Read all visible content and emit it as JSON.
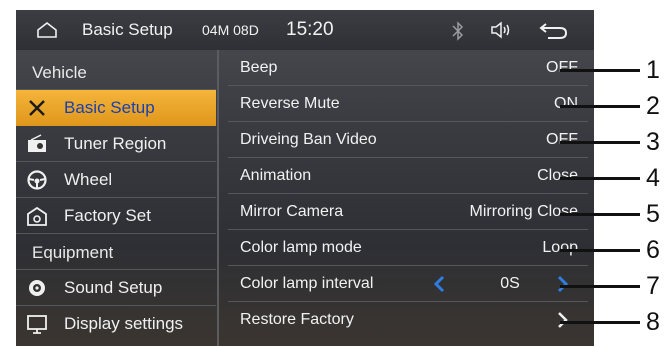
{
  "status": {
    "title": "Basic Setup",
    "date": "04M 08D",
    "time": "15:20"
  },
  "sidebar": {
    "header1": "Vehicle",
    "items1": [
      {
        "label": "Basic Setup",
        "icon": "wrench-screwdriver-icon",
        "active": true
      },
      {
        "label": "Tuner Region",
        "icon": "radio-icon"
      },
      {
        "label": "Wheel",
        "icon": "steering-wheel-icon"
      },
      {
        "label": "Factory Set",
        "icon": "factory-icon"
      }
    ],
    "header2": "Equipment",
    "items2": [
      {
        "label": "Sound Setup",
        "icon": "speaker-icon"
      },
      {
        "label": "Display settings",
        "icon": "display-icon"
      }
    ]
  },
  "settings": [
    {
      "label": "Beep",
      "value": "OFF"
    },
    {
      "label": "Reverse Mute",
      "value": "ON"
    },
    {
      "label": "Driveing Ban Video",
      "value": "OFF"
    },
    {
      "label": "Animation",
      "value": "Close"
    },
    {
      "label": "Mirror Camera",
      "value": "Mirroring Close"
    },
    {
      "label": "Color lamp mode",
      "value": "Loop"
    },
    {
      "label": "Color lamp interval",
      "value": "0S"
    },
    {
      "label": "Restore Factory",
      "value": ""
    }
  ],
  "callouts": [
    "1",
    "2",
    "3",
    "4",
    "5",
    "6",
    "7",
    "8"
  ],
  "colors": {
    "accent": "#e8a12a",
    "active_text": "#1a3fae",
    "arrow": "#2f7de0"
  }
}
